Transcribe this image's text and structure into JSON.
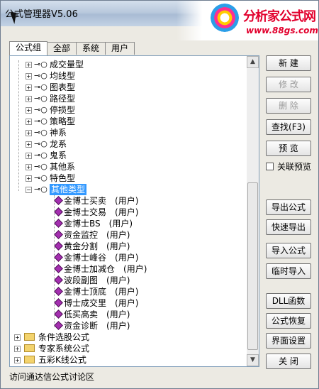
{
  "window": {
    "title": "公式管理器V5.06"
  },
  "logo": {
    "brand": "分析家公式网",
    "url": "www.88gs.com"
  },
  "tabs": [
    "公式组",
    "全部",
    "系统",
    "用户"
  ],
  "tree": {
    "groups": [
      "成交量型",
      "均线型",
      "图表型",
      "路径型",
      "停损型",
      "策略型",
      "神系",
      "龙系",
      "鬼系",
      "其他系",
      "特色型"
    ],
    "expanded_group": "其他类型",
    "items": [
      {
        "name": "金博士买卖",
        "tag": "(用户)"
      },
      {
        "name": "金博士交易",
        "tag": "(用户)"
      },
      {
        "name": "金博士BS",
        "tag": "(用户)"
      },
      {
        "name": "资金监控",
        "tag": "(用户)"
      },
      {
        "name": "黄金分割",
        "tag": "(用户)"
      },
      {
        "name": "金博士峰谷",
        "tag": "(用户)"
      },
      {
        "name": "金博士加减仓",
        "tag": "(用户)"
      },
      {
        "name": "波段副图",
        "tag": "(用户)"
      },
      {
        "name": "金博士顶底",
        "tag": "(用户)"
      },
      {
        "name": "博士成交里",
        "tag": "(用户)"
      },
      {
        "name": "低买高卖",
        "tag": "(用户)"
      },
      {
        "name": "资金诊断",
        "tag": "(用户)"
      }
    ],
    "folders": [
      "条件选股公式",
      "专家系统公式",
      "五彩K线公式"
    ]
  },
  "buttons": {
    "new": "新 建",
    "modify": "修 改",
    "delete": "删 除",
    "find": "查找(F3)",
    "preview": "预 览",
    "export": "导出公式",
    "quick_export": "快速导出",
    "import": "导入公式",
    "temp_import": "临时导入",
    "dll": "DLL函数",
    "restore": "公式恢复",
    "ui_settings": "界面设置",
    "close": "关 闭"
  },
  "linked_preview": {
    "label": "关联预览",
    "checked": false
  },
  "status": {
    "text": "访问通达信公式讨论区"
  }
}
